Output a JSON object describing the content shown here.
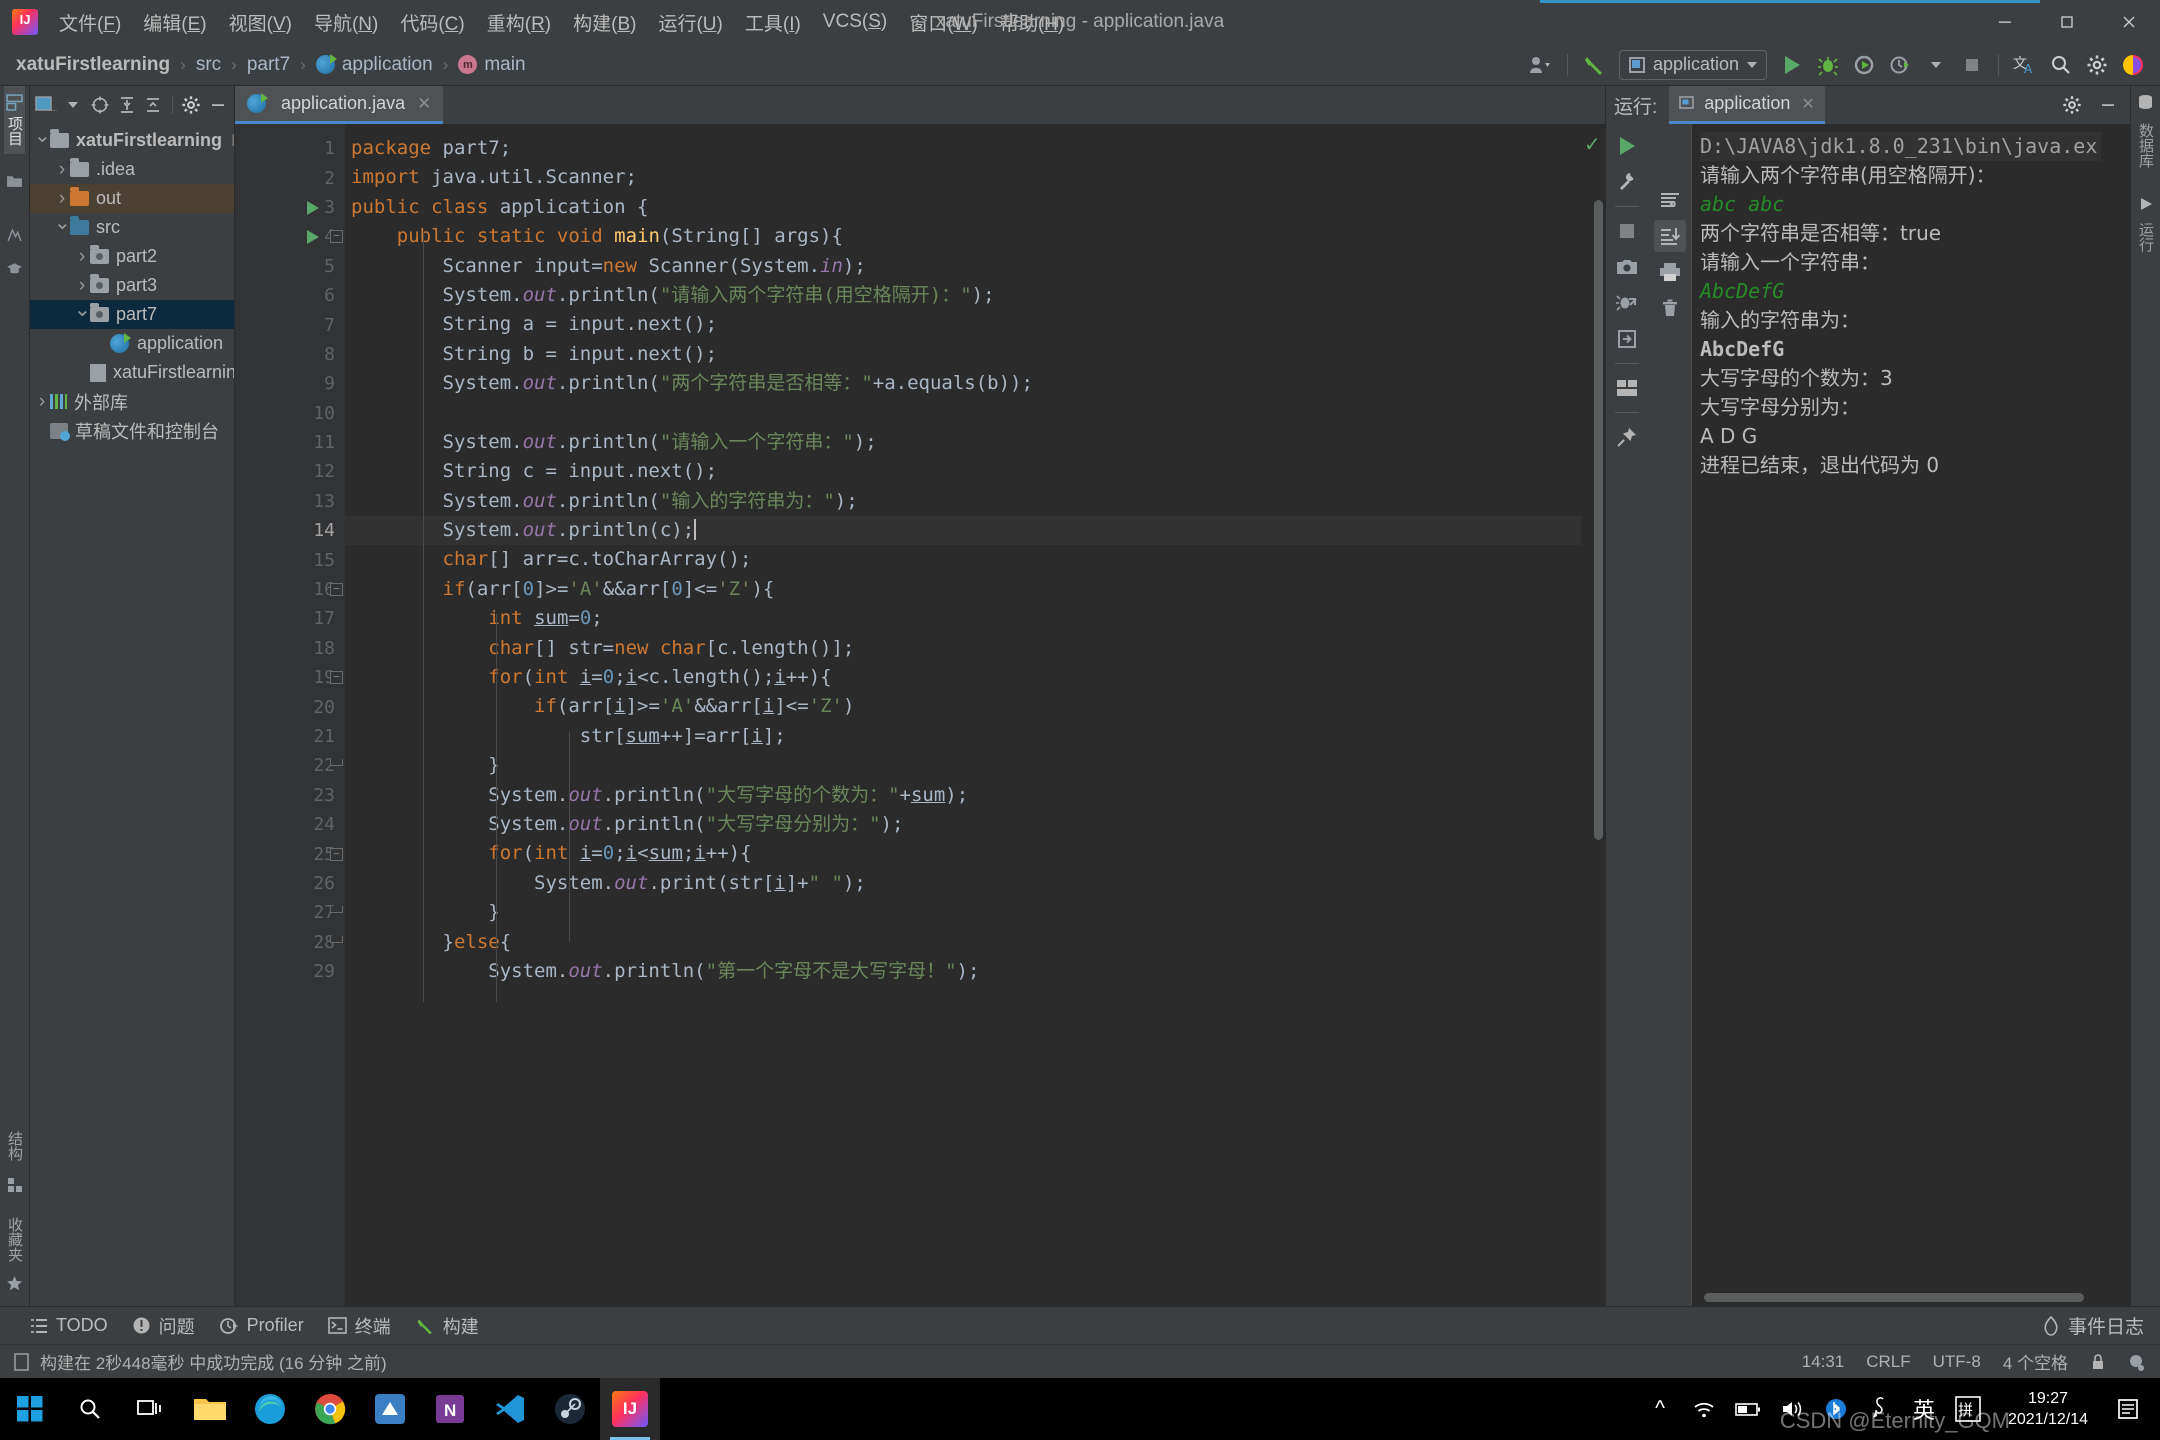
{
  "window": {
    "title": "xatuFirstlearning - application.java",
    "minimize_label": "—",
    "maximize_label": "❐",
    "close_label": "✕"
  },
  "menu": [
    {
      "label": "文件(F)",
      "name": "menu-file"
    },
    {
      "label": "编辑(E)",
      "name": "menu-edit"
    },
    {
      "label": "视图(V)",
      "name": "menu-view"
    },
    {
      "label": "导航(N)",
      "name": "menu-navigate"
    },
    {
      "label": "代码(C)",
      "name": "menu-code"
    },
    {
      "label": "重构(R)",
      "name": "menu-refactor"
    },
    {
      "label": "构建(B)",
      "name": "menu-build"
    },
    {
      "label": "运行(U)",
      "name": "menu-run"
    },
    {
      "label": "工具(I)",
      "name": "menu-tools"
    },
    {
      "label": "VCS(S)",
      "name": "menu-vcs"
    },
    {
      "label": "窗口(W)",
      "name": "menu-window"
    },
    {
      "label": "帮助(H)",
      "name": "menu-help"
    }
  ],
  "breadcrumb": [
    {
      "label": "xatuFirstlearning",
      "icon": "none"
    },
    {
      "label": "src",
      "icon": "none"
    },
    {
      "label": "part7",
      "icon": "none"
    },
    {
      "label": "application",
      "icon": "class-icon"
    },
    {
      "label": "main",
      "icon": "method-icon"
    }
  ],
  "toolbar": {
    "run_config": "application",
    "icons": [
      "user-avatar-icon",
      "build-hammer-icon",
      "run-icon",
      "debug-icon",
      "run-coverage-icon",
      "profiler-icon",
      "stop-icon",
      "translate-icon",
      "search-icon",
      "settings-gear-icon",
      "intellij-icon"
    ]
  },
  "left_strip": {
    "tabs": [
      {
        "label": "项目",
        "name": "tool-tab-project",
        "active": true
      },
      {
        "label": "结构",
        "name": "tool-tab-structure",
        "active": false
      },
      {
        "label": "收藏夹",
        "name": "tool-tab-favorites",
        "active": false
      }
    ]
  },
  "project_panel": {
    "title_icon": "project-view-icon",
    "buttons": [
      "select-target-icon",
      "expand-all-icon",
      "collapse-all-icon",
      "settings-gear-icon",
      "hide-icon"
    ],
    "tree": [
      {
        "label": "xatuFirstlearning",
        "suffix": "D:\\code",
        "indent": 0,
        "arrow": "open",
        "icon": "module-folder",
        "bold": true,
        "state": "none"
      },
      {
        "label": ".idea",
        "suffix": "",
        "indent": 1,
        "arrow": "closed",
        "icon": "folder-grey",
        "bold": false,
        "state": "none"
      },
      {
        "label": "out",
        "suffix": "",
        "indent": 1,
        "arrow": "closed",
        "icon": "folder-orange",
        "bold": false,
        "state": "highlight-brown"
      },
      {
        "label": "src",
        "suffix": "",
        "indent": 1,
        "arrow": "open",
        "icon": "folder-blue",
        "bold": false,
        "state": "none"
      },
      {
        "label": "part2",
        "suffix": "",
        "indent": 2,
        "arrow": "closed",
        "icon": "package-icon",
        "bold": false,
        "state": "none"
      },
      {
        "label": "part3",
        "suffix": "",
        "indent": 2,
        "arrow": "closed",
        "icon": "package-icon",
        "bold": false,
        "state": "none"
      },
      {
        "label": "part7",
        "suffix": "",
        "indent": 2,
        "arrow": "open",
        "icon": "package-icon",
        "bold": false,
        "state": "selected-blue"
      },
      {
        "label": "application",
        "suffix": "",
        "indent": 3,
        "arrow": "none",
        "icon": "java-class-icon",
        "bold": false,
        "state": "none"
      },
      {
        "label": "xatuFirstlearning.iml",
        "suffix": "",
        "indent": 2,
        "arrow": "none",
        "icon": "iml-file-icon",
        "bold": false,
        "state": "none"
      },
      {
        "label": "外部库",
        "suffix": "",
        "indent": 0,
        "arrow": "closed",
        "icon": "library-icon",
        "bold": false,
        "state": "none"
      },
      {
        "label": "草稿文件和控制台",
        "suffix": "",
        "indent": 0,
        "arrow": "none",
        "icon": "scratches-icon",
        "bold": false,
        "state": "none"
      }
    ]
  },
  "editor": {
    "tab": {
      "label": "application.java",
      "icon": "java-class-icon",
      "close": "✕"
    },
    "current_line": 14,
    "lines": [
      {
        "n": 1,
        "run": false,
        "fold": "",
        "html": "<span class=\"kw\">package</span> part7;"
      },
      {
        "n": 2,
        "run": false,
        "fold": "",
        "html": "<span class=\"kw\">import</span> java.util.Scanner;"
      },
      {
        "n": 3,
        "run": true,
        "fold": "",
        "html": "<span class=\"kw\">public class</span> application {"
      },
      {
        "n": 4,
        "run": true,
        "fold": "start",
        "html": "    <span class=\"kw\">public static void</span> <span class=\"mth\">main</span>(String[] args){"
      },
      {
        "n": 5,
        "run": false,
        "fold": "",
        "html": "        Scanner input=<span class=\"kw\">new</span> Scanner(System.<span class=\"fld\">in</span>);"
      },
      {
        "n": 6,
        "run": false,
        "fold": "",
        "html": "        System.<span class=\"fld\">out</span>.println(<span class=\"st\">\"请输入两个字符串(用空格隔开)：\"</span>);"
      },
      {
        "n": 7,
        "run": false,
        "fold": "",
        "html": "        String a = input.next();"
      },
      {
        "n": 8,
        "run": false,
        "fold": "",
        "html": "        String b = input.next();"
      },
      {
        "n": 9,
        "run": false,
        "fold": "",
        "html": "        System.<span class=\"fld\">out</span>.println(<span class=\"st\">\"两个字符串是否相等：\"</span>+a.equals(b));"
      },
      {
        "n": 10,
        "run": false,
        "fold": "",
        "html": ""
      },
      {
        "n": 11,
        "run": false,
        "fold": "",
        "html": "        System.<span class=\"fld\">out</span>.println(<span class=\"st\">\"请输入一个字符串：\"</span>);"
      },
      {
        "n": 12,
        "run": false,
        "fold": "",
        "html": "        String c = input.next();"
      },
      {
        "n": 13,
        "run": false,
        "fold": "",
        "html": "        System.<span class=\"fld\">out</span>.println(<span class=\"st\">\"输入的字符串为：\"</span>);"
      },
      {
        "n": 14,
        "run": false,
        "fold": "",
        "html": "        System.<span class=\"fld\">out</span>.println(c);<span class=\"caretbar\"></span>"
      },
      {
        "n": 15,
        "run": false,
        "fold": "",
        "html": "        <span class=\"kw\">char</span>[] arr=c.toCharArray();"
      },
      {
        "n": 16,
        "run": false,
        "fold": "start",
        "html": "        <span class=\"kw\">if</span>(arr[<span class=\"nm\">0</span>]&gt;=<span class=\"st\">'A'</span>&amp;&amp;arr[<span class=\"nm\">0</span>]&lt;=<span class=\"st\">'Z'</span>){"
      },
      {
        "n": 17,
        "run": false,
        "fold": "",
        "html": "            <span class=\"kw\">int</span> <span class=\"var-u\">sum</span>=<span class=\"nm\">0</span>;"
      },
      {
        "n": 18,
        "run": false,
        "fold": "",
        "html": "            <span class=\"kw\">char</span>[] str=<span class=\"kw\">new char</span>[c.length()];"
      },
      {
        "n": 19,
        "run": false,
        "fold": "start",
        "html": "            <span class=\"kw\">for</span>(<span class=\"kw\">int</span> <span class=\"var-u\">i</span>=<span class=\"nm\">0</span>;<span class=\"var-u\">i</span>&lt;c.length();<span class=\"var-u\">i</span>++){"
      },
      {
        "n": 20,
        "run": false,
        "fold": "",
        "html": "                <span class=\"kw\">if</span>(arr[<span class=\"var-u\">i</span>]&gt;=<span class=\"st\">'A'</span>&amp;&amp;arr[<span class=\"var-u\">i</span>]&lt;=<span class=\"st\">'Z'</span>)"
      },
      {
        "n": 21,
        "run": false,
        "fold": "",
        "html": "                    str[<span class=\"var-u\">sum</span>++]=arr[<span class=\"var-u\">i</span>];"
      },
      {
        "n": 22,
        "run": false,
        "fold": "end",
        "html": "            }"
      },
      {
        "n": 23,
        "run": false,
        "fold": "",
        "html": "            System.<span class=\"fld\">out</span>.println(<span class=\"st\">\"大写字母的个数为：\"</span>+<span class=\"var-u\">sum</span>);"
      },
      {
        "n": 24,
        "run": false,
        "fold": "",
        "html": "            System.<span class=\"fld\">out</span>.println(<span class=\"st\">\"大写字母分别为：\"</span>);"
      },
      {
        "n": 25,
        "run": false,
        "fold": "start",
        "html": "            <span class=\"kw\">for</span>(<span class=\"kw\">int</span> <span class=\"var-u\">i</span>=<span class=\"nm\">0</span>;<span class=\"var-u\">i</span>&lt;<span class=\"var-u\">sum</span>;<span class=\"var-u\">i</span>++){"
      },
      {
        "n": 26,
        "run": false,
        "fold": "",
        "html": "                System.<span class=\"fld\">out</span>.print(str[<span class=\"var-u\">i</span>]+<span class=\"st\">\" \"</span>);"
      },
      {
        "n": 27,
        "run": false,
        "fold": "end",
        "html": "            }"
      },
      {
        "n": 28,
        "run": false,
        "fold": "end",
        "html": "        }<span class=\"kw\">else</span>{"
      },
      {
        "n": 29,
        "run": false,
        "fold": "",
        "html": "            System.<span class=\"fld\">out</span>.println(<span class=\"st\">\"第一个字母不是大写字母！\"</span>);"
      }
    ]
  },
  "run_window": {
    "label": "运行:",
    "tab": "application",
    "tab_close": "✕",
    "head_buttons": [
      "settings-gear-icon",
      "hide-icon"
    ],
    "side_buttons": [
      "rerun-icon",
      "run-settings-icon",
      "stop-icon",
      "camera-icon",
      "dump-threads-icon",
      "exit-icon",
      "layout-icon",
      "pin-icon"
    ],
    "console_buttons": [
      "soft-wrap-icon",
      "scroll-to-end-icon",
      "print-icon",
      "clear-all-icon"
    ],
    "console": [
      {
        "text": "D:\\JAVA8\\jdk1.8.0_231\\bin\\java.ex",
        "style": "command"
      },
      {
        "text": "请输入两个字符串(用空格隔开)：",
        "style": "normal"
      },
      {
        "text": "abc abc",
        "style": "user-input"
      },
      {
        "text": "两个字符串是否相等：true",
        "style": "normal"
      },
      {
        "text": "请输入一个字符串：",
        "style": "normal"
      },
      {
        "text": "AbcDefG",
        "style": "user-input"
      },
      {
        "text": "输入的字符串为：",
        "style": "normal"
      },
      {
        "text": "AbcDefG",
        "style": "bold"
      },
      {
        "text": "大写字母的个数为：3",
        "style": "normal"
      },
      {
        "text": "大写字母分别为：",
        "style": "normal"
      },
      {
        "text": "A D G",
        "style": "normal"
      },
      {
        "text": "进程已结束，退出代码为 0",
        "style": "normal"
      }
    ]
  },
  "right_strip": {
    "tabs": [
      {
        "label": "数据库",
        "name": "tool-tab-database"
      },
      {
        "label": "运行",
        "name": "tool-tab-run"
      }
    ]
  },
  "bottom_bar": {
    "items": [
      {
        "label": "TODO",
        "icon": "todo-icon",
        "name": "bottom-tab-todo"
      },
      {
        "label": "问题",
        "icon": "problems-icon",
        "name": "bottom-tab-problems"
      },
      {
        "label": "Profiler",
        "icon": "profiler-icon",
        "name": "bottom-tab-profiler"
      },
      {
        "label": "终端",
        "icon": "terminal-icon",
        "name": "bottom-tab-terminal"
      },
      {
        "label": "构建",
        "icon": "build-hammer-icon",
        "name": "bottom-tab-build"
      }
    ],
    "event_log": "事件日志"
  },
  "status_bar": {
    "message": "构建在 2秒448毫秒 中成功完成 (16 分钟 之前)",
    "position": "14:31",
    "line_separator": "CRLF",
    "encoding": "UTF-8",
    "indent": "4 个空格",
    "lock_icon": "lock-icon",
    "inspections_icon": "inspections-icon"
  },
  "taskbar": {
    "start_icon": "windows-start-icon",
    "search_icon": "search-icon",
    "taskview_icon": "task-view-icon",
    "apps": [
      {
        "name": "file-explorer",
        "label": "",
        "color": "#f8c44a"
      },
      {
        "name": "microsoft-edge",
        "label": "",
        "color": "#1a9ed9"
      },
      {
        "name": "google-chrome",
        "label": "",
        "color": "#dd4b3e"
      },
      {
        "name": "app-blue-box",
        "label": "",
        "color": "#3c7ec4"
      },
      {
        "name": "microsoft-onenote",
        "label": "N",
        "color": "#7a3b96"
      },
      {
        "name": "visual-studio-code",
        "label": "",
        "color": "#2196d6"
      },
      {
        "name": "steam",
        "label": "",
        "color": "#2a3f5a"
      },
      {
        "name": "intellij-idea",
        "label": "",
        "color": "#f97a12"
      }
    ],
    "tray": [
      "show-hidden-icon",
      "wifi-icon",
      "battery-icon",
      "volume-icon",
      "bluetooth-icon",
      "pen-icon",
      "ime-eng-icon",
      "ime-pinyin-icon"
    ],
    "clock_time": "19:27",
    "clock_date": "2021/12/14",
    "notification_icon": "notification-icon",
    "watermark": "CSDN @Eternity_GQM"
  },
  "colors": {
    "accent": "#3592c4",
    "bg_panel": "#3c3f41",
    "bg_editor": "#2b2b2b",
    "keyword": "#cc7832",
    "string": "#6a8759",
    "number": "#6897bb",
    "field": "#9876aa",
    "method": "#ffc66d",
    "selection_blue": "#0d293e",
    "highlight_brown": "#4b4132",
    "green_run": "#59a869"
  }
}
